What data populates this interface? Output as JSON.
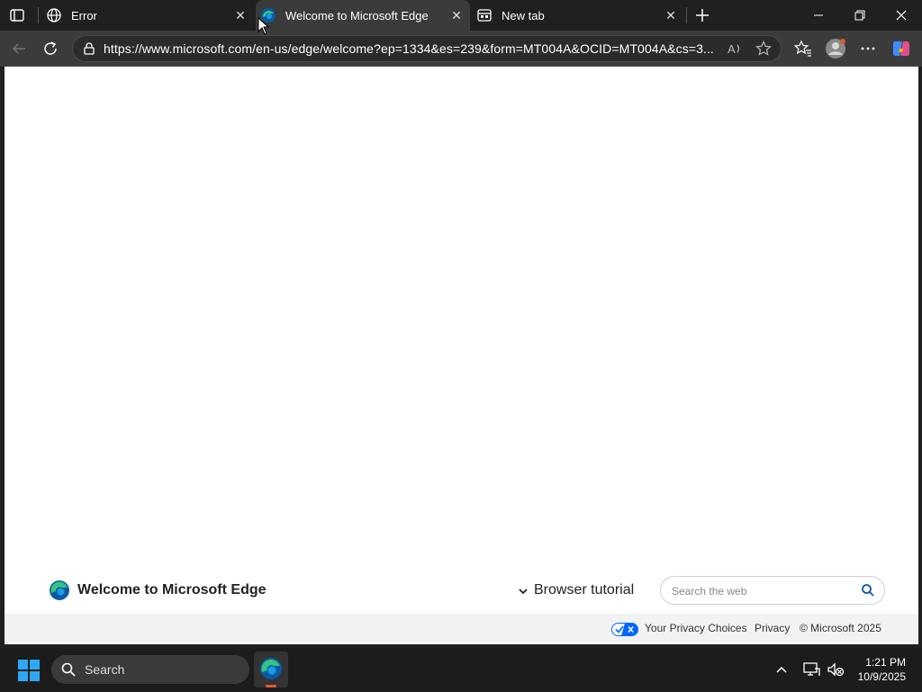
{
  "tabs": [
    {
      "title": "Error",
      "icon": "globe-icon",
      "active": false
    },
    {
      "title": "Welcome to Microsoft Edge",
      "icon": "edge-logo-icon",
      "active": true
    },
    {
      "title": "New tab",
      "icon": "newtab-icon",
      "active": false
    }
  ],
  "toolbar": {
    "url": "https://www.microsoft.com/en-us/edge/welcome?ep=1334&es=239&form=MT004A&OCID=MT004A&cs=3..."
  },
  "page": {
    "title": "Welcome to Microsoft Edge",
    "tutorial_label": "Browser tutorial",
    "search_placeholder": "Search the web",
    "footer": {
      "privacy_choices": "Your Privacy Choices",
      "privacy": "Privacy",
      "copyright": "© Microsoft 2025"
    }
  },
  "taskbar": {
    "search_label": "Search",
    "time": "1:21 PM",
    "date": "10/9/2025"
  },
  "colors": {
    "edge_blue": "#0c59a4",
    "edge_green": "#33c481",
    "accent_orange": "#e05a2b"
  }
}
